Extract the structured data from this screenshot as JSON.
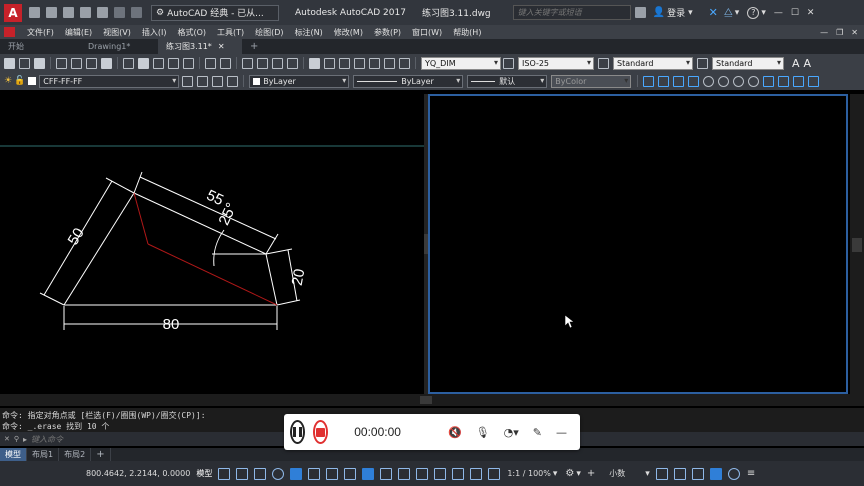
{
  "titlebar": {
    "workspace": "AutoCAD 经典 - 已从...",
    "app_title": "Autodesk AutoCAD 2017",
    "file_name": "练习图3.11.dwg",
    "search_placeholder": "键入关键字或短语",
    "login_label": "登录",
    "help_icon": "?"
  },
  "menu": [
    "文件(F)",
    "编辑(E)",
    "视图(V)",
    "插入(I)",
    "格式(O)",
    "工具(T)",
    "绘图(D)",
    "标注(N)",
    "修改(M)",
    "参数(P)",
    "窗口(W)",
    "帮助(H)"
  ],
  "tabs": [
    {
      "label": "开始",
      "active": false
    },
    {
      "label": "Drawing1*",
      "active": false
    },
    {
      "label": "练习图3.11*",
      "active": true
    },
    {
      "label": "+",
      "active": false
    }
  ],
  "toolbar1": {
    "dim_style": "YQ_DIM",
    "dim_standard": "ISO-25",
    "text_style": "Standard",
    "table_style": "Standard",
    "text_btn_1": "A",
    "text_btn_2": "A"
  },
  "toolbar2": {
    "layer": "CFF-FF-FF",
    "color": "ByLayer",
    "linetype": "ByLayer",
    "lineweight": "默认",
    "plot_style": "ByColor"
  },
  "drawing": {
    "dim_55": "55",
    "dim_25": "25°",
    "dim_50": "50",
    "dim_20": "20",
    "dim_80": "80",
    "line_color": "#ffffff",
    "red_line_color": "#b01818",
    "guide_color": "#2f6f6f"
  },
  "command": {
    "history_1": "命令: 指定对角点或 [栏选(F)/圈围(WP)/圈交(CP)]:",
    "history_2": "命令: _.erase 找到 10 个",
    "input_placeholder": "键入命令"
  },
  "layout_tabs": [
    {
      "label": "模型",
      "active": true
    },
    {
      "label": "布局1",
      "active": false
    },
    {
      "label": "布局2",
      "active": false
    },
    {
      "label": "+",
      "active": false
    }
  ],
  "status": {
    "coords": "800.4642, 2.2144, 0.0000",
    "model": "模型",
    "scale": "1:1 / 100%",
    "units": "小数"
  },
  "recorder": {
    "time": "00:00:00"
  },
  "colors": {
    "accent": "#2f7fd8",
    "record_red": "#e03030",
    "viewport_border": "#2c5fa0"
  }
}
